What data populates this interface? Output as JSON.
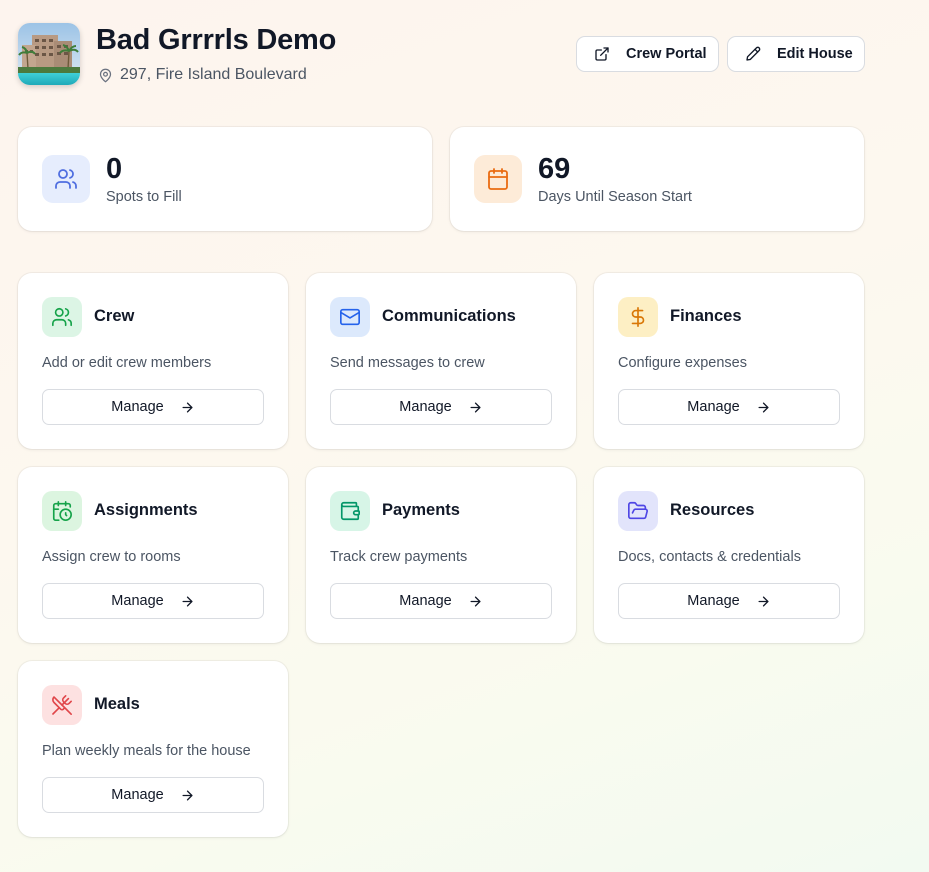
{
  "header": {
    "title": "Bad Grrrrls Demo",
    "address": "297, Fire Island Boulevard",
    "crew_portal_label": "Crew Portal",
    "edit_house_label": "Edit House"
  },
  "stats": [
    {
      "value": "0",
      "label": "Spots to Fill",
      "icon": "users-icon",
      "color": "#4f6ee0",
      "bg": "#e6edfd"
    },
    {
      "value": "69",
      "label": "Days Until Season Start",
      "icon": "calendar-icon",
      "color": "#ea6c12",
      "bg": "#fdebd8"
    }
  ],
  "cards": [
    {
      "title": "Crew",
      "description": "Add or edit crew members",
      "button": "Manage",
      "icon": "users-icon",
      "color": "#16a34a",
      "bg": "#dcf5e5"
    },
    {
      "title": "Communications",
      "description": "Send messages to crew",
      "button": "Manage",
      "icon": "mail-icon",
      "color": "#2563eb",
      "bg": "#dce9fc"
    },
    {
      "title": "Finances",
      "description": "Configure expenses",
      "button": "Manage",
      "icon": "dollar-icon",
      "color": "#d97706",
      "bg": "#fdefc4"
    },
    {
      "title": "Assignments",
      "description": "Assign crew to rooms",
      "button": "Manage",
      "icon": "calendar-clock-icon",
      "color": "#16a34a",
      "bg": "#dcf5e0"
    },
    {
      "title": "Payments",
      "description": "Track crew payments",
      "button": "Manage",
      "icon": "wallet-icon",
      "color": "#059669",
      "bg": "#d7f5e7"
    },
    {
      "title": "Resources",
      "description": "Docs, contacts & credentials",
      "button": "Manage",
      "icon": "folder-open-icon",
      "color": "#4f46e5",
      "bg": "#e2e4fb"
    },
    {
      "title": "Meals",
      "description": "Plan weekly meals for the house",
      "button": "Manage",
      "icon": "utensils-crossed-icon",
      "color": "#e0464a",
      "bg": "#fde1e1"
    }
  ]
}
